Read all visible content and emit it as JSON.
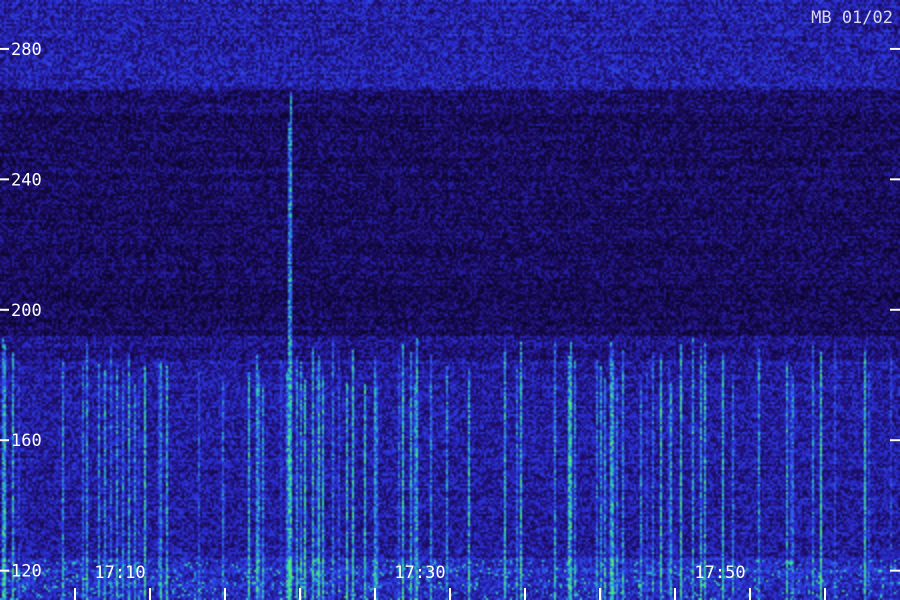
{
  "chart_data": {
    "type": "heatmap",
    "title": "",
    "xlabel": "",
    "ylabel": "",
    "stamp": "MB 01/02",
    "y_ticks": [
      {
        "value": 120,
        "label": "120"
      },
      {
        "value": 160,
        "label": "160"
      },
      {
        "value": 200,
        "label": "200"
      },
      {
        "value": 240,
        "label": "240"
      },
      {
        "value": 280,
        "label": "280"
      }
    ],
    "x_labels": [
      {
        "value": "17:10",
        "label": "17:10"
      },
      {
        "value": "17:30",
        "label": "17:30"
      },
      {
        "value": "17:50",
        "label": "17:50"
      }
    ],
    "ylim": [
      111,
      295
    ],
    "xlim": [
      "17:02",
      "18:02"
    ],
    "x_minor_tick_minutes": 5,
    "colors": {
      "background": "#0a0530",
      "low": "#160a5a",
      "mid": "#2a30d8",
      "high": "#20e0a0",
      "labels": "#ffffff"
    }
  }
}
